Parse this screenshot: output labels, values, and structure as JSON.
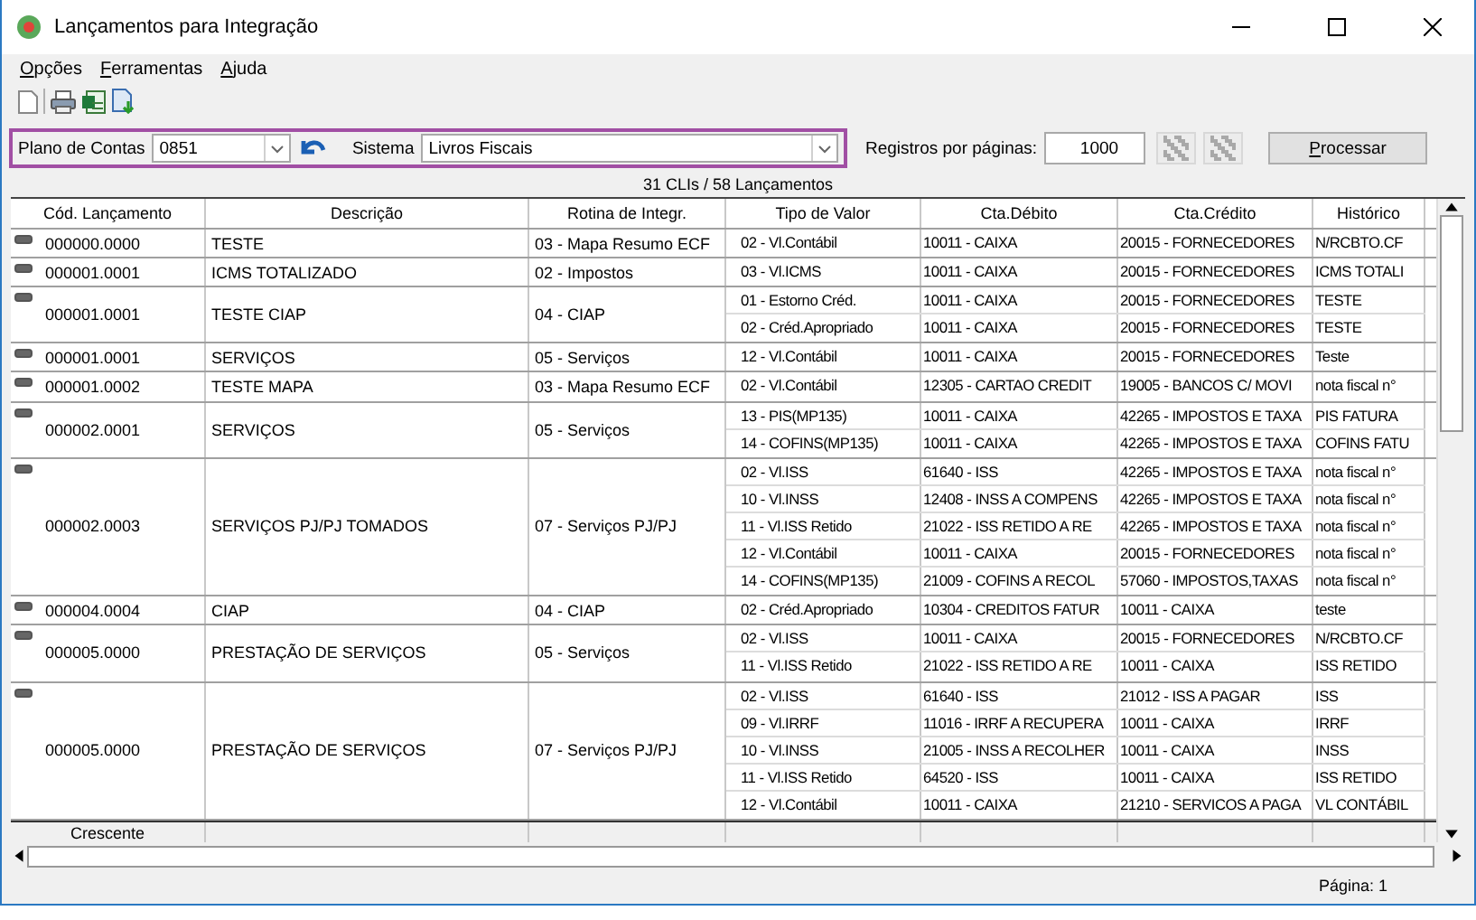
{
  "window": {
    "title": "Lançamentos para Integração"
  },
  "menu": [
    "Opções",
    "Ferramentas",
    "Ajuda"
  ],
  "filters": {
    "plano_label": "Plano de Contas",
    "plano_value": "0851",
    "sistema_label": "Sistema",
    "sistema_value": "Livros Fiscais",
    "registros_label": "Registros por páginas:",
    "registros_value": "1000",
    "process_button": "Processar"
  },
  "summary": "31 CLIs / 58 Lançamentos",
  "table": {
    "columns": [
      "Cód. Lançamento",
      "Descrição",
      "Rotina de Integr.",
      "Tipo de Valor",
      "Cta.Débito",
      "Cta.Crédito",
      "Histórico"
    ],
    "groups": [
      {
        "code": "000000.0000",
        "description": "TESTE",
        "routine": "03 - Mapa Resumo ECF",
        "expanded": true,
        "rows": [
          [
            "02 - Vl.Contábil",
            "10011 - CAIXA",
            "20015 - FORNECEDORES",
            "N/RCBTO.CF"
          ]
        ]
      },
      {
        "code": "000001.0001",
        "description": "ICMS TOTALIZADO",
        "routine": "02 - Impostos",
        "expanded": true,
        "rows": [
          [
            "03 - Vl.ICMS",
            "10011 - CAIXA",
            "20015 - FORNECEDORES",
            "ICMS TOTALI"
          ]
        ]
      },
      {
        "code": "000001.0001",
        "description": "TESTE CIAP",
        "routine": "04 - CIAP",
        "expanded": true,
        "rows": [
          [
            "01 - Estorno Créd.",
            "10011 - CAIXA",
            "20015 - FORNECEDORES",
            "TESTE"
          ],
          [
            "02 - Créd.Apropriado",
            "10011 - CAIXA",
            "20015 - FORNECEDORES",
            "TESTE"
          ]
        ]
      },
      {
        "code": "000001.0001",
        "description": "SERVIÇOS",
        "routine": "05 - Serviços",
        "expanded": true,
        "rows": [
          [
            "12 - Vl.Contábil",
            "10011 - CAIXA",
            "20015 - FORNECEDORES",
            "Teste"
          ]
        ]
      },
      {
        "code": "000001.0002",
        "description": "TESTE MAPA",
        "routine": "03 - Mapa Resumo ECF",
        "expanded": true,
        "rows": [
          [
            "02 - Vl.Contábil",
            "12305 - CARTAO CREDIT",
            "19005 - BANCOS C/ MOVI",
            "nota fiscal n°"
          ]
        ]
      },
      {
        "code": "000002.0001",
        "description": "SERVIÇOS",
        "routine": "05 - Serviços",
        "expanded": true,
        "rows": [
          [
            "13 - PIS(MP135)",
            "10011 - CAIXA",
            "42265 - IMPOSTOS E TAXA",
            "PIS FATURA"
          ],
          [
            "14 - COFINS(MP135)",
            "10011 - CAIXA",
            "42265 - IMPOSTOS E TAXA",
            "COFINS FATU"
          ]
        ]
      },
      {
        "code": "000002.0003",
        "description": "SERVIÇOS PJ/PJ TOMADOS",
        "routine": "07 - Serviços PJ/PJ",
        "expanded": true,
        "rows": [
          [
            "02 - Vl.ISS",
            "61640 - ISS",
            "42265 - IMPOSTOS E TAXA",
            "nota fiscal n°"
          ],
          [
            "10 - Vl.INSS",
            "12408 - INSS A COMPENS",
            "42265 - IMPOSTOS E TAXA",
            "nota fiscal n°"
          ],
          [
            "11 - Vl.ISS Retido",
            "21022 - ISS RETIDO A RE",
            "42265 - IMPOSTOS E TAXA",
            "nota fiscal n°"
          ],
          [
            "12 - Vl.Contábil",
            "10011 - CAIXA",
            "20015 - FORNECEDORES",
            "nota fiscal n°"
          ],
          [
            "14 - COFINS(MP135)",
            "21009 - COFINS A RECOL",
            "57060 - IMPOSTOS,TAXAS",
            "nota fiscal n°"
          ]
        ]
      },
      {
        "code": "000004.0004",
        "description": "CIAP",
        "routine": "04 - CIAP",
        "expanded": true,
        "rows": [
          [
            "02 - Créd.Apropriado",
            "10304 - CREDITOS FATUR",
            "10011 - CAIXA",
            "teste"
          ]
        ]
      },
      {
        "code": "000005.0000",
        "description": "PRESTAÇÃO DE SERVIÇOS",
        "routine": "05 - Serviços",
        "expanded": true,
        "rows": [
          [
            "02 - Vl.ISS",
            "10011 - CAIXA",
            "20015 - FORNECEDORES",
            "N/RCBTO.CF"
          ],
          [
            "11 - Vl.ISS Retido",
            "21022 - ISS RETIDO A RE",
            "10011 - CAIXA",
            "ISS RETIDO"
          ]
        ]
      },
      {
        "code": "000005.0000",
        "description": "PRESTAÇÃO DE SERVIÇOS",
        "routine": "07 - Serviços PJ/PJ",
        "expanded": true,
        "rows": [
          [
            "02 - Vl.ISS",
            "61640 - ISS",
            "21012 - ISS A PAGAR",
            "ISS"
          ],
          [
            "09 - Vl.IRRF",
            "11016 - IRRF A RECUPERA",
            "10011 - CAIXA",
            "IRRF"
          ],
          [
            "10 - Vl.INSS",
            "21005 - INSS A RECOLHER",
            "10011 - CAIXA",
            "INSS"
          ],
          [
            "11 - Vl.ISS Retido",
            "64520 - ISS",
            "10011 - CAIXA",
            "ISS RETIDO"
          ],
          [
            "12 - Vl.Contábil",
            "10011 - CAIXA",
            "21210 - SERVICOS A PAGA",
            "VL CONTÁBIL"
          ]
        ]
      }
    ],
    "footer": "Crescente"
  },
  "status_bar": "Página: 1"
}
